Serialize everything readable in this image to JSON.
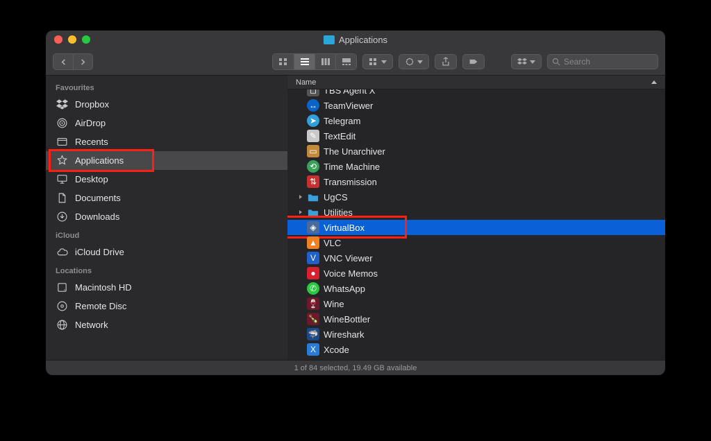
{
  "window": {
    "title": "Applications",
    "search_placeholder": "Search",
    "status": "1 of 84 selected, 19.49 GB available",
    "column_header": "Name"
  },
  "sidebar": {
    "sections": [
      {
        "title": "Favourites",
        "items": [
          {
            "icon": "dropbox",
            "label": "Dropbox"
          },
          {
            "icon": "airdrop",
            "label": "AirDrop"
          },
          {
            "icon": "recents",
            "label": "Recents"
          },
          {
            "icon": "applications",
            "label": "Applications",
            "selected": true,
            "highlight": true
          },
          {
            "icon": "desktop",
            "label": "Desktop"
          },
          {
            "icon": "documents",
            "label": "Documents"
          },
          {
            "icon": "downloads",
            "label": "Downloads"
          }
        ]
      },
      {
        "title": "iCloud",
        "items": [
          {
            "icon": "icloud",
            "label": "iCloud Drive"
          }
        ]
      },
      {
        "title": "Locations",
        "items": [
          {
            "icon": "hdd",
            "label": "Macintosh HD"
          },
          {
            "icon": "disc",
            "label": "Remote Disc"
          },
          {
            "icon": "network",
            "label": "Network"
          }
        ]
      }
    ]
  },
  "files": [
    {
      "name": "TBS Agent X",
      "icon": "generic",
      "clipped": true
    },
    {
      "name": "TeamViewer",
      "icon": "teamviewer"
    },
    {
      "name": "Telegram",
      "icon": "telegram"
    },
    {
      "name": "TextEdit",
      "icon": "textedit"
    },
    {
      "name": "The Unarchiver",
      "icon": "unarchiver"
    },
    {
      "name": "Time Machine",
      "icon": "timemachine"
    },
    {
      "name": "Transmission",
      "icon": "transmission"
    },
    {
      "name": "UgCS",
      "icon": "folder",
      "expandable": true
    },
    {
      "name": "Utilities",
      "icon": "folder",
      "expandable": true
    },
    {
      "name": "VirtualBox",
      "icon": "virtualbox",
      "selected": true,
      "highlight": true
    },
    {
      "name": "VLC",
      "icon": "vlc"
    },
    {
      "name": "VNC Viewer",
      "icon": "vnc"
    },
    {
      "name": "Voice Memos",
      "icon": "voicememos"
    },
    {
      "name": "WhatsApp",
      "icon": "whatsapp"
    },
    {
      "name": "Wine",
      "icon": "wine"
    },
    {
      "name": "WineBottler",
      "icon": "winebottler"
    },
    {
      "name": "Wireshark",
      "icon": "wireshark"
    },
    {
      "name": "Xcode",
      "icon": "xcode"
    }
  ]
}
